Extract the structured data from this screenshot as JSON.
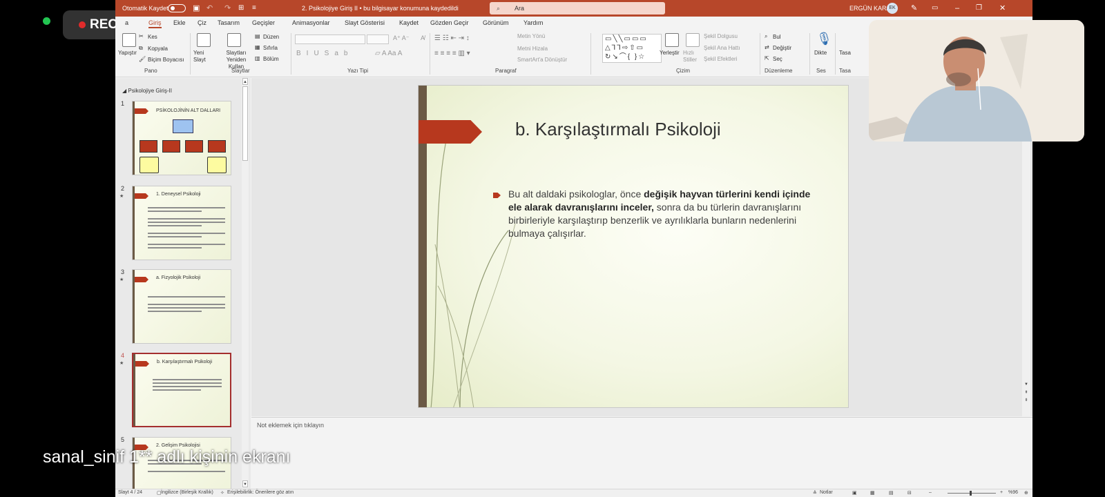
{
  "overlay": {
    "rec_label": "REC",
    "screen_caption": "sanal_sinif 1** adlı kişinin ekranı"
  },
  "titlebar": {
    "autosave_label": "Otomatik Kaydet",
    "doc_title": "2. Psikolojiye Giriş II  •  bu bilgisayar konumuna kaydedildi",
    "search_placeholder": "Ara",
    "user_name": "ERGÜN KARA",
    "user_initials": "EK"
  },
  "ribbon": {
    "tabs": [
      "Giriş",
      "Ekle",
      "Çiz",
      "Tasarım",
      "Geçişler",
      "Animasyonlar",
      "Slayt Gösterisi",
      "Kaydet",
      "Gözden Geçir",
      "Görünüm",
      "Yardım"
    ],
    "active_tab": "Giriş",
    "pano": {
      "paste": "Yapıştır",
      "cut": "Kes",
      "copy": "Kopyala",
      "format_painter": "Biçim Boyacısı",
      "group": "Pano"
    },
    "slaytlar": {
      "new_slide": "Yeni Slayt",
      "reuse": "Slaytları Yeniden Kullan",
      "layout": "Düzen",
      "reset": "Sıfırla",
      "section": "Bölüm",
      "group": "Slaytlar"
    },
    "yazi_tipi": {
      "group": "Yazı Tipi"
    },
    "paragraf": {
      "text_direction": "Metin Yönü",
      "align_text": "Metni Hizala",
      "smartart": "SmartArt'a Dönüştür",
      "group": "Paragraf"
    },
    "cizim": {
      "arrange": "Yerleştir",
      "quick_styles": "Hızlı Stiller",
      "shape_fill": "Şekil Dolgusu",
      "shape_outline": "Şekil Ana Hattı",
      "shape_effects": "Şekil Efektleri",
      "group": "Çizim"
    },
    "duzenleme": {
      "find": "Bul",
      "replace": "Değiştir",
      "select": "Seç",
      "group": "Düzenleme"
    },
    "ses": {
      "dictate": "Dikte",
      "group": "Ses"
    },
    "tasarimci": {
      "label": "Tasa",
      "group": "Tasa"
    }
  },
  "thumbnails": {
    "section_title": "Psikolojiye Giriş-II",
    "slides": [
      {
        "num": "1",
        "title": "PSİKOLOJİNİN ALT DALLARI",
        "star": ""
      },
      {
        "num": "2",
        "title": "1. Deneysel Psikoloji",
        "star": "★"
      },
      {
        "num": "3",
        "title": "a. Fizyolojik Psikoloji",
        "star": "★"
      },
      {
        "num": "4",
        "title": "b. Karşılaştırmalı Psikoloji",
        "star": "★"
      },
      {
        "num": "5",
        "title": "2. Gelişim Psikolojisi",
        "star": ""
      }
    ],
    "active_index": 3
  },
  "slide": {
    "title": "b. Karşılaştırmalı Psikoloji",
    "body_part1": "Bu alt daldaki psikologlar, önce ",
    "body_bold": "değişik hayvan türlerini kendi içinde ele alarak davranışlarını inceler,",
    "body_part2": " sonra da bu türlerin davranışlarını birbirleriyle karşılaştırıp benzerlik ve ayrılıklarla bunların nedenlerini bulmaya çalışırlar."
  },
  "notes": {
    "placeholder": "Not eklemek için tıklayın"
  },
  "statusbar": {
    "slide_counter": "Slayt 4 / 24",
    "language": "İngilizce (Birleşik Krallık)",
    "accessibility": "Erişilebilirlik: Önerilere göz atın",
    "notes_button": "Notlar",
    "zoom": "%96"
  },
  "colors": {
    "ppt_accent": "#b7472a",
    "slide_arrow": "#b7381e",
    "rec_dot": "#e02b2b",
    "status_dot": "#23c552"
  }
}
